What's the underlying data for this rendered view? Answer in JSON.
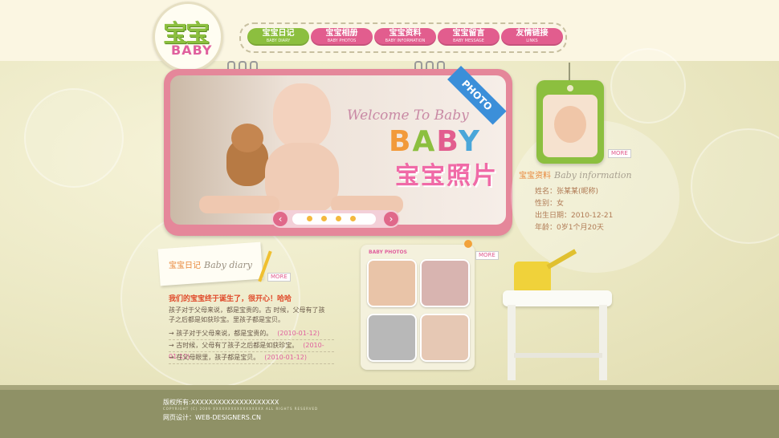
{
  "logo": {
    "cn": "宝宝",
    "en": "BABY"
  },
  "nav": [
    {
      "title": "宝宝日记",
      "sub": "BABY DIARY",
      "color": "#8cbf3f"
    },
    {
      "title": "宝宝相册",
      "sub": "BABY PHOTOS",
      "color": "#e25d8e"
    },
    {
      "title": "宝宝资料",
      "sub": "BABY INFORMATION",
      "color": "#e25d8e"
    },
    {
      "title": "宝宝留言",
      "sub": "BABY MESSAGE",
      "color": "#e25d8e"
    },
    {
      "title": "友情链接",
      "sub": "LINKS",
      "color": "#e25d8e"
    }
  ],
  "banner": {
    "welcome": "Welcome To Baby",
    "baby_word": "BABY",
    "baby_cn": "宝宝照片",
    "photo_tag": "PHOTO",
    "prev_icon": "chevron-left-icon",
    "next_icon": "chevron-right-icon"
  },
  "profile": {
    "more": "MORE",
    "title_cn": "宝宝资料",
    "title_en": "Baby information",
    "rows": [
      {
        "label": "姓名：",
        "value": "张某某(昵称)"
      },
      {
        "label": "性别：",
        "value": "女"
      },
      {
        "label": "出生日期：",
        "value": "2010-12-21"
      },
      {
        "label": "年龄：",
        "value": "0岁1个月20天"
      }
    ]
  },
  "diary": {
    "title_cn": "宝宝日记",
    "title_en": "Baby diary",
    "more": "MORE",
    "headline": "我们的宝宝终于诞生了，很开心！哈哈",
    "text": "孩子对于父母来说，都是宝贵的。古 时候，父母有了孩子之后都是如获珍宝。里孩子都是宝贝。",
    "items": [
      {
        "text": "孩子对于父母来说，都是宝贵的。",
        "date": "(2010-01-12)"
      },
      {
        "text": "古时候，父母有了孩子之后都是如获珍宝。",
        "date": "(2010-01-12)"
      },
      {
        "text": "在父母眼里，孩子都是宝贝。",
        "date": "(2010-01-12)"
      }
    ]
  },
  "photos": {
    "title": "BABY PHOTOS",
    "more": "MORE"
  },
  "footer": {
    "copyright": "版权所有:XXXXXXXXXXXXXXXXXXXX",
    "copyright_en": "COPYRIGHT (C) 2009 XXXXXXXXXXXXXXXXX ALL RIGHTS RESERVED",
    "design": "网页设计：WEB-DESIGNERS.CN"
  },
  "colors": {
    "accent_pink": "#e25d8e",
    "accent_green": "#8cbf3f",
    "accent_orange": "#e8883c",
    "footer": "#8f9166"
  }
}
